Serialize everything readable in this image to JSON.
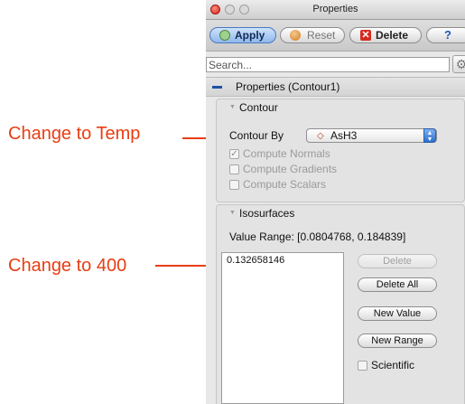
{
  "window": {
    "title": "Properties"
  },
  "toolbar": {
    "apply_label": "Apply",
    "reset_label": "Reset",
    "delete_label": "Delete",
    "help_label": "?"
  },
  "search": {
    "placeholder": "Search..."
  },
  "section": {
    "title": "Properties (Contour1)"
  },
  "contour": {
    "title": "Contour",
    "contour_by_label": "Contour By",
    "contour_by_value": "AsH3",
    "checkboxes": [
      {
        "label": "Compute Normals",
        "checked": true
      },
      {
        "label": "Compute Gradients",
        "checked": false
      },
      {
        "label": "Compute Scalars",
        "checked": false
      }
    ]
  },
  "isosurfaces": {
    "title": "Isosurfaces",
    "value_range_label": "Value Range: [0.0804768, 0.184839]",
    "values": [
      "0.132658146"
    ],
    "delete_label": "Delete",
    "delete_all_label": "Delete All",
    "new_value_label": "New Value",
    "new_range_label": "New Range",
    "scientific_label": "Scientific"
  },
  "annotations": {
    "change_temp": "Change to Temp",
    "change_400": "Change to 400"
  },
  "colors": {
    "annotation": "#e83d13",
    "apply_accent": "#8fb8ec"
  }
}
